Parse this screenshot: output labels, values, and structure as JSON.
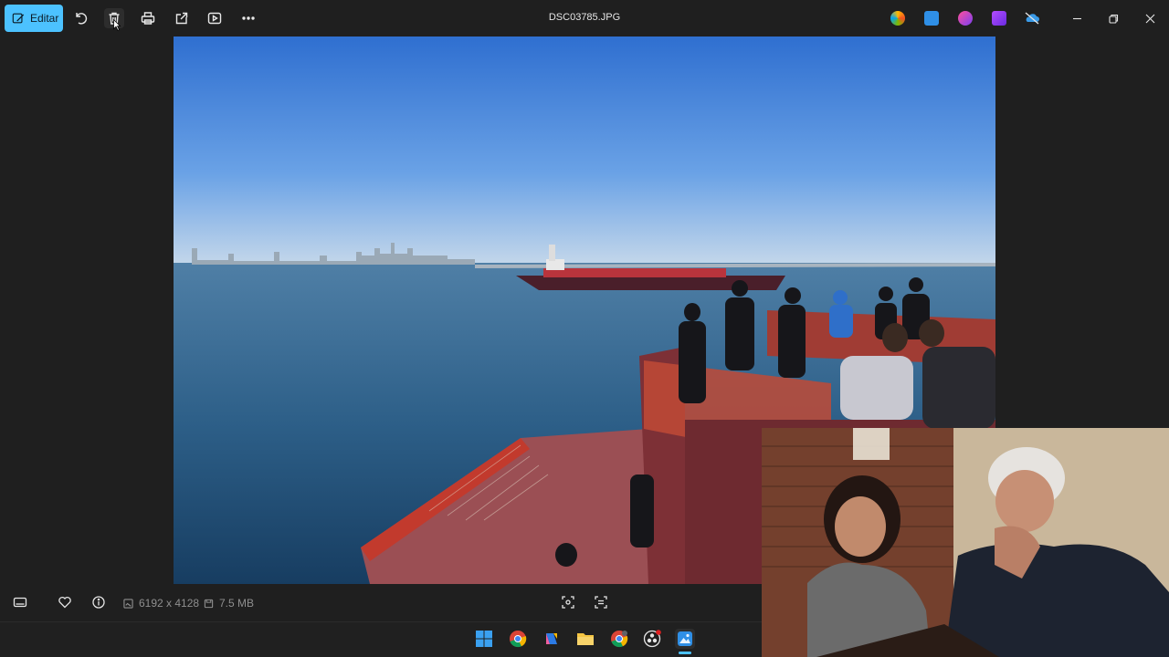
{
  "toolbar": {
    "edit_label": "Editar",
    "file_name": "DSC03785.JPG",
    "icons": [
      "rotate-icon",
      "delete-icon",
      "print-icon",
      "share-icon",
      "slideshow-icon",
      "more-icon"
    ]
  },
  "header_apps": [
    "copilot-icon",
    "photos-editor-icon",
    "designer-icon",
    "clipchamp-icon",
    "onedrive-icon"
  ],
  "window_controls": [
    "minimize",
    "restore",
    "close"
  ],
  "info_bar": {
    "dimensions": "6192 x 4128",
    "file_size": "7.5 MB"
  },
  "taskbar": {
    "apps": [
      "start",
      "chrome",
      "copilot",
      "file-explorer",
      "chrome-profile",
      "obs",
      "photos"
    ],
    "active": "photos"
  },
  "colors": {
    "accent": "#4cc2ff",
    "background": "#1f1f1f"
  }
}
